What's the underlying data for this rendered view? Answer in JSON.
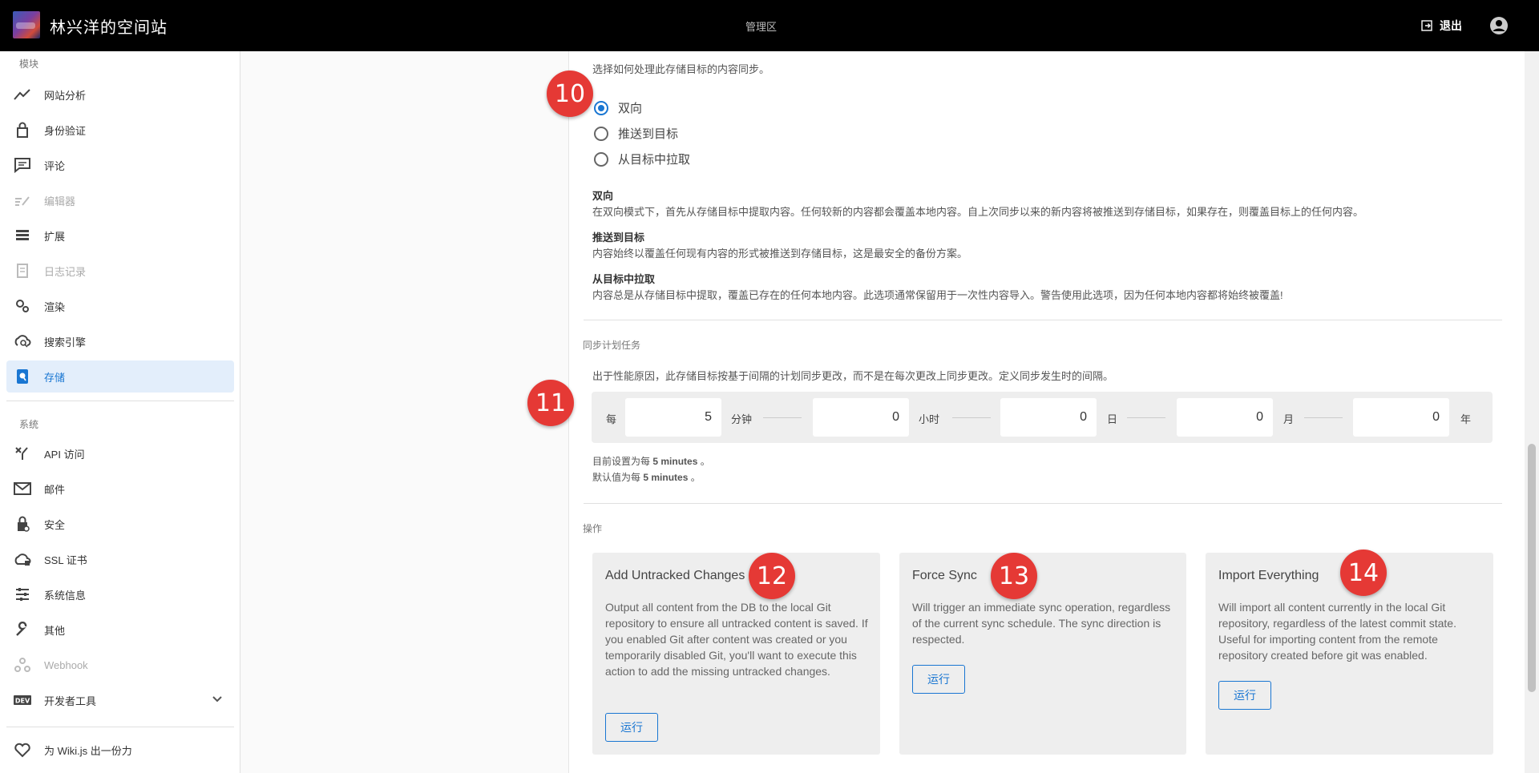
{
  "header": {
    "site_title": "林兴洋的空间站",
    "center_label": "管理区",
    "logout_label": "退出",
    "logout_icon": "logout-icon",
    "account_icon": "account-circle-icon"
  },
  "sidebar": {
    "modules_label": "模块",
    "system_label": "系统",
    "items": [
      {
        "label": "网站分析",
        "icon": "trending-up-icon",
        "disabled": false
      },
      {
        "label": "身份验证",
        "icon": "lock-icon",
        "disabled": false
      },
      {
        "label": "评论",
        "icon": "comment-icon",
        "disabled": false
      },
      {
        "label": "编辑器",
        "icon": "editor-icon",
        "disabled": true
      },
      {
        "label": "扩展",
        "icon": "extension-icon",
        "disabled": false
      },
      {
        "label": "日志记录",
        "icon": "log-icon",
        "disabled": true
      },
      {
        "label": "渲染",
        "icon": "gears-icon",
        "disabled": false
      },
      {
        "label": "搜索引擎",
        "icon": "cloud-search-icon",
        "disabled": false
      },
      {
        "label": "存储",
        "icon": "storage-icon",
        "disabled": false,
        "active": true
      }
    ],
    "system_items": [
      {
        "label": "API 访问",
        "icon": "api-icon",
        "disabled": false
      },
      {
        "label": "邮件",
        "icon": "mail-icon",
        "disabled": false
      },
      {
        "label": "安全",
        "icon": "security-lock-icon",
        "disabled": false
      },
      {
        "label": "SSL 证书",
        "icon": "cloud-lock-icon",
        "disabled": false
      },
      {
        "label": "系统信息",
        "icon": "tune-icon",
        "disabled": false
      },
      {
        "label": "其他",
        "icon": "wrench-icon",
        "disabled": false
      },
      {
        "label": "Webhook",
        "icon": "webhook-icon",
        "disabled": true
      },
      {
        "label": "开发者工具",
        "icon": "dev-icon",
        "disabled": false
      }
    ],
    "contribute_label": "为 Wiki.js 出一份力",
    "contribute_icon": "heart-icon"
  },
  "sync": {
    "direction_hint": "选择如何处理此存储目标的内容同步。",
    "options": [
      "双向",
      "推送到目标",
      "从目标中拉取"
    ],
    "selected": "双向",
    "descriptions": [
      {
        "title": "双向",
        "text": "在双向模式下，首先从存储目标中提取内容。任何较新的内容都会覆盖本地内容。自上次同步以来的新内容将被推送到存储目标，如果存在，则覆盖目标上的任何内容。"
      },
      {
        "title": "推送到目标",
        "text": "内容始终以覆盖任何现有内容的形式被推送到存储目标，这是最安全的备份方案。"
      },
      {
        "title": "从目标中拉取",
        "text": "内容总是从存储目标中提取，覆盖已存在的任何本地内容。此选项通常保留用于一次性内容导入。警告使用此选项，因为任何本地内容都将始终被覆盖!"
      }
    ]
  },
  "schedule": {
    "section_label": "同步计划任务",
    "hint": "出于性能原因，此存储目标按基于间隔的计划同步更改，而不是在每次更改上同步更改。定义同步发生时的间隔。",
    "every_label": "每",
    "fields": [
      {
        "value": "5",
        "unit": "分钟"
      },
      {
        "value": "0",
        "unit": "小时"
      },
      {
        "value": "0",
        "unit": "日"
      },
      {
        "value": "0",
        "unit": "月"
      },
      {
        "value": "0",
        "unit": "年"
      }
    ],
    "current_prefix": "目前设置为每",
    "current_value": "5 minutes",
    "current_suffix": "。",
    "default_prefix": "默认值为每",
    "default_value": "5 minutes",
    "default_suffix": "。"
  },
  "actions": {
    "section_label": "操作",
    "cards": [
      {
        "title": "Add Untracked Changes",
        "desc": "Output all content from the DB to the local Git repository to ensure all untracked content is saved. If you enabled Git after content was created or you temporarily disabled Git, you'll want to execute this action to add the missing untracked changes.",
        "button": "运行"
      },
      {
        "title": "Force Sync",
        "desc": "Will trigger an immediate sync operation, regardless of the current sync schedule. The sync direction is respected.",
        "button": "运行"
      },
      {
        "title": "Import Everything",
        "desc": "Will import all content currently in the local Git repository, regardless of the latest commit state. Useful for importing content from the remote repository created before git was enabled.",
        "button": "运行"
      }
    ]
  },
  "annotations": [
    "10",
    "11",
    "12",
    "13",
    "14"
  ],
  "colors": {
    "accent": "#1976d2",
    "badge": "#e53935",
    "topbar": "#000000"
  }
}
